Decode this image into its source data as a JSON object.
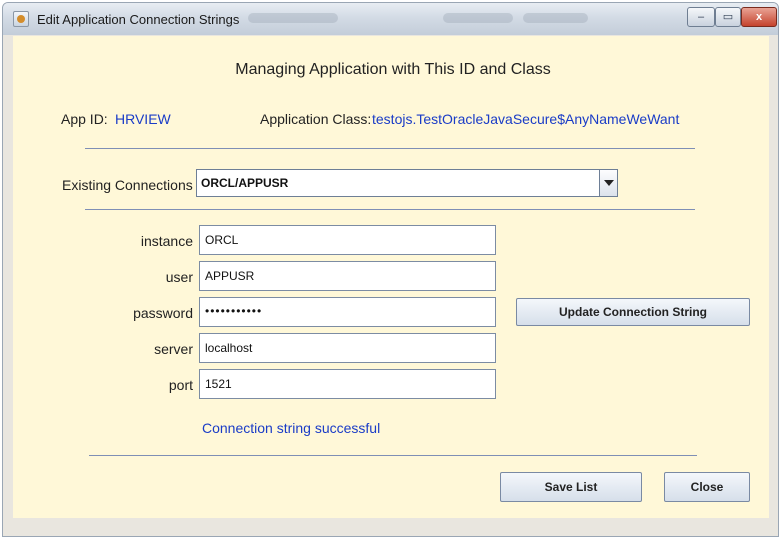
{
  "window": {
    "title": "Edit Application Connection Strings",
    "controls": {
      "minimize": "–",
      "maximize": "▭",
      "close": "x"
    }
  },
  "heading": "Managing Application with This ID and Class",
  "app": {
    "id_label": "App ID:",
    "id_value": "HRVIEW",
    "class_label": "Application Class:",
    "class_value": "testojs.TestOracleJavaSecure$AnyNameWeWant"
  },
  "connections": {
    "label": "Existing Connections",
    "selected": "ORCL/APPUSR"
  },
  "fields": {
    "instance": {
      "label": "instance",
      "value": "ORCL"
    },
    "user": {
      "label": "user",
      "value": "APPUSR"
    },
    "password": {
      "label": "password",
      "value": "•••••••••••"
    },
    "server": {
      "label": "server",
      "value": "localhost"
    },
    "port": {
      "label": "port",
      "value": "1521"
    }
  },
  "buttons": {
    "update": "Update Connection String",
    "save": "Save List",
    "close": "Close"
  },
  "status": "Connection string successful",
  "colors": {
    "panel_bg": "#fff8d8",
    "accent_text": "#1a3cc7",
    "divider": "#7f8fb5"
  }
}
